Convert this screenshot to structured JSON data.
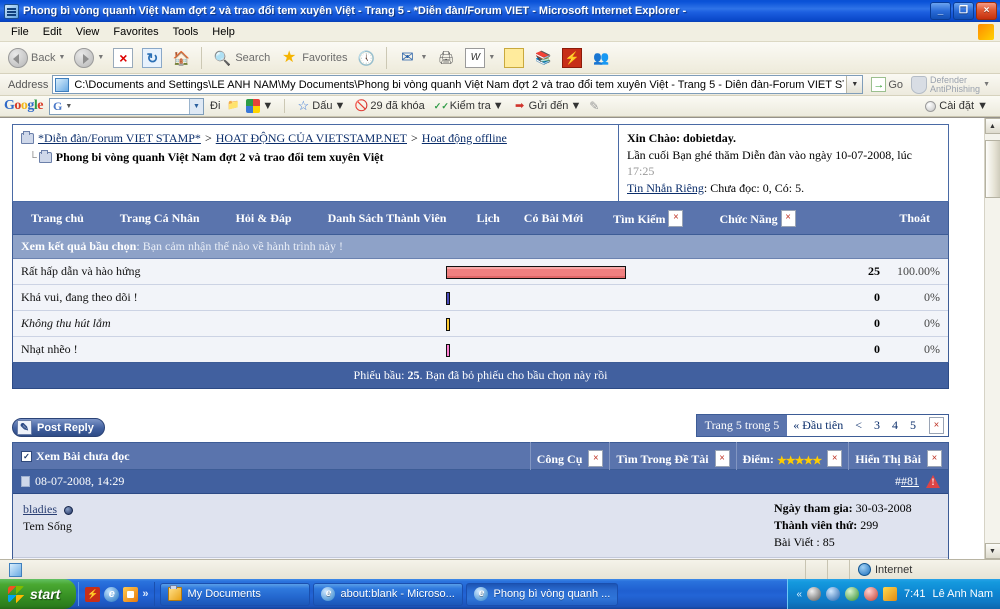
{
  "window": {
    "title": "Phong bì vòng quanh Việt Nam đợt 2 và trao đổi tem xuyên Việt - Trang 5 - *Diễn đàn/Forum VIET  - Microsoft Internet Explorer -",
    "minimize_label": "_",
    "restore_label": "❐",
    "close_label": "×"
  },
  "menubar": {
    "items": [
      "File",
      "Edit",
      "View",
      "Favorites",
      "Tools",
      "Help"
    ]
  },
  "toolbar": {
    "back_label": "Back",
    "search_label": "Search",
    "favorites_label": "Favorites",
    "icons": [
      "back-icon",
      "forward-icon",
      "stop-icon",
      "refresh-icon",
      "home-icon",
      "search-icon",
      "favorites-star-icon",
      "history-icon",
      "mail-icon",
      "print-icon",
      "edit-icon",
      "notes-icon",
      "encarta-icon",
      "flash-icon",
      "messenger-icon"
    ]
  },
  "address": {
    "label": "Address",
    "value": "C:\\Documents and Settings\\LE ANH NAM\\My Documents\\Phong bi vòng quanh Việt Nam đợt 2 và trao đổi tem xuyên Việt - Trang 5 - Diễn đàn-Forum VIET STAMP.htm",
    "placeholder": "",
    "go_label": "Go",
    "go_arrow": "→",
    "defender_line1": "Defender",
    "defender_line2": "AntiPhishing"
  },
  "google_toolbar": {
    "logo": [
      "G",
      "o",
      "o",
      "g",
      "l",
      "e"
    ],
    "search_placeholder": "",
    "search_prefix": "G",
    "go_label": "Đi",
    "bookmarks_label": "Dấu",
    "blocked_label": "29 đã khóa",
    "check_label": "Kiểm tra",
    "send_label": "Gửi đến",
    "settings_label": "Cài đặt"
  },
  "forum": {
    "breadcrumb": {
      "items": [
        "*Diễn đàn/Forum VIET STAMP*",
        "HOAT ĐỘNG CỦA VIETSTAMP.NET",
        "Hoat động offline"
      ],
      "separator": ">",
      "current": "Phong bi vòng quanh Việt Nam đợt 2 và trao đổi tem xuyên Việt"
    },
    "welcome": {
      "greeting_label": "Xin Chào:",
      "username": "dobietday.",
      "lastvisit_text": "Lần cuối Bạn ghé thăm Diễn đàn vào ngày 10-07-2008, lúc",
      "lastvisit_time": "17:25",
      "pm_link": "Tin Nhắn Riêng",
      "pm_status": ": Chưa đọc: 0, Có: 5."
    },
    "nav": [
      "Trang chủ",
      "Trang Cá Nhân",
      "Hỏi & Đáp",
      "Danh Sách Thành Viên",
      "Lịch",
      "Có Bài Mới",
      "Tìm Kiếm",
      "Chức Năng",
      "Thoát"
    ],
    "poll": {
      "header_bold": "Xem kết quả bầu chọn",
      "header_question": ": Bạn cảm nhận thế nào về hành trình này !",
      "footer_prefix": "Phiếu bầu:",
      "footer_count": "25",
      "footer_suffix": ". Bạn đã bỏ phiếu cho bầu chọn này rồi",
      "rows": [
        {
          "label": "Rất hấp dẫn và hào hứng",
          "votes": "25",
          "percent": "100.00%",
          "bar_pct": 100,
          "color": "#f08080",
          "italic": false
        },
        {
          "label": "Khá vui, đang theo dõi !",
          "votes": "0",
          "percent": "0%",
          "bar_pct": 0,
          "color": "#4b4bbd",
          "italic": false
        },
        {
          "label": "Không thu hút lắm",
          "votes": "0",
          "percent": "0%",
          "bar_pct": 0,
          "color": "#ffcc33",
          "italic": true
        },
        {
          "label": "Nhạt nhẽo !",
          "votes": "0",
          "percent": "0%",
          "bar_pct": 0,
          "color": "#ff7fd4",
          "italic": false
        }
      ]
    },
    "post_reply_label": "Post Reply",
    "pager": {
      "current_text": "Trang 5 trong 5",
      "first_label": "« Đầu tiên",
      "prev_label": "<",
      "pages": [
        "3",
        "4",
        "5"
      ]
    },
    "toolstrip": {
      "unread_label": "Xem Bài chưa đọc",
      "tools_label": "Công Cụ",
      "search_thread_label": "Tìm Trong Đề Tài",
      "rating_label": "Điểm:",
      "rating_stars": "★★★★★",
      "display_label": "Hiển Thị Bài"
    },
    "post": {
      "date": "08-07-2008, 14:29",
      "number": "#81",
      "username": "bladies",
      "usertitle": "Tem Sống",
      "joined_label": "Ngày tham gia:",
      "joined_value": "30-03-2008",
      "memberno_label": "Thành viên thứ:",
      "memberno_value": "299",
      "posts_label": "Bài Viết :",
      "posts_value": "85"
    }
  },
  "statusbar": {
    "zone": "Internet"
  },
  "taskbar": {
    "start_label": "start",
    "tasks": [
      "My Documents",
      "about:blank - Microso...",
      "Phong bì vòng quanh ..."
    ],
    "clock": "7:41",
    "user": "Lê Anh Nam"
  }
}
